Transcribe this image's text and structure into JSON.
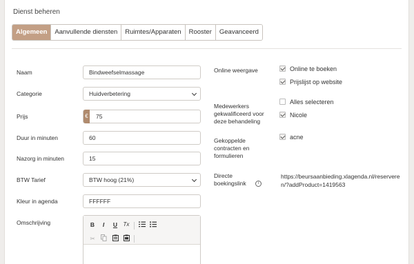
{
  "header": {
    "title": "Dienst beheren"
  },
  "tabs": [
    {
      "label": "Algemeen"
    },
    {
      "label": "Aanvullende diensten"
    },
    {
      "label": "Ruimtes/Apparaten"
    },
    {
      "label": "Rooster"
    },
    {
      "label": "Geavanceerd"
    }
  ],
  "form": {
    "naam": {
      "label": "Naam",
      "value": "Bindweefselmassage"
    },
    "categorie": {
      "label": "Categorie",
      "value": "Huidverbetering"
    },
    "prijs": {
      "label": "Prijs",
      "currency": "€",
      "value": "75"
    },
    "duur": {
      "label": "Duur in minuten",
      "value": "60"
    },
    "nazorg": {
      "label": "Nazorg in minuten",
      "value": "15"
    },
    "btw": {
      "label": "BTW Tarief",
      "value": "BTW hoog (21%)"
    },
    "kleur": {
      "label": "Kleur in agenda",
      "value": "FFFFFF"
    },
    "omschrijving": {
      "label": "Omschrijving"
    }
  },
  "editor_toolbar": {
    "bold": "B",
    "italic": "I",
    "underline": "U",
    "clear_format": "Tx",
    "icons": [
      "numbered-list-icon",
      "bullet-list-icon",
      "cut-icon",
      "copy-icon",
      "paste-icon",
      "paste-text-icon"
    ]
  },
  "right": {
    "online": {
      "label": "Online weergave",
      "options": [
        {
          "label": "Online te boeken",
          "checked": true
        },
        {
          "label": "Prijslijst op website",
          "checked": true
        }
      ]
    },
    "medewerkers": {
      "label": "Medewerkers gekwalificeerd voor deze behandeling",
      "label_lines": [
        "Medewerkers",
        "gekwalificeerd voor",
        "deze behandeling"
      ],
      "options": [
        {
          "label": "Alles selecteren",
          "checked": false
        },
        {
          "label": "Nicole",
          "checked": true
        }
      ]
    },
    "contracten": {
      "label_lines": [
        "Gekoppelde",
        "contracten en",
        "formulieren"
      ],
      "options": [
        {
          "label": "acne",
          "checked": true
        }
      ]
    },
    "boekingslink": {
      "label_lines": [
        "Directe",
        "boekingslink"
      ],
      "url": "https://beursaanbieding.xlagenda.nl/reserveren/?addProduct=1419563"
    }
  },
  "colors": {
    "accent": "#c39f85",
    "addon": "#b08b6e",
    "background": "#efedeb"
  }
}
